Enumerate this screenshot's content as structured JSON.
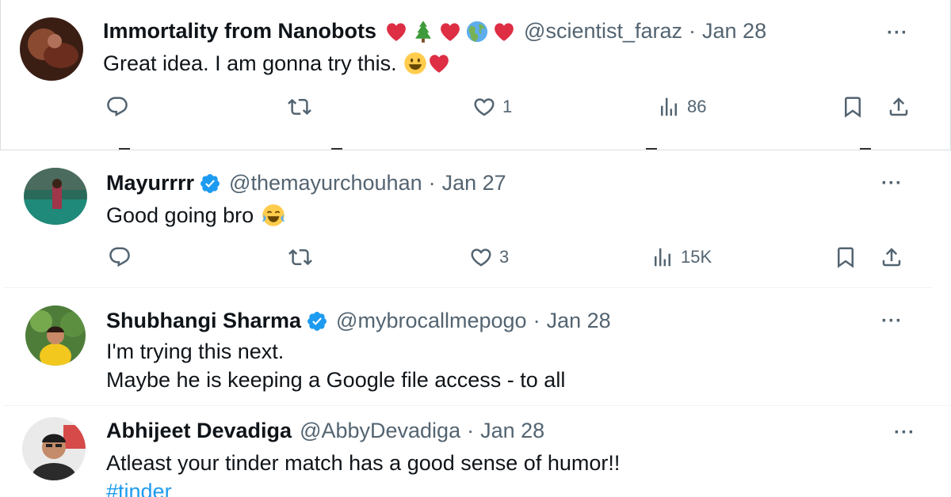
{
  "tweets": [
    {
      "name": "Immortality from Nanobots",
      "name_emojis": [
        "heart",
        "tree",
        "heart",
        "globe",
        "heart"
      ],
      "handle": "@scientist_faraz",
      "separator": "·",
      "date": "Jan 28",
      "text": "Great idea. I am gonna try this.",
      "text_emojis": [
        "smiley",
        "heart"
      ],
      "more": "···",
      "likes": "1",
      "views": "86"
    },
    {
      "name": "Mayurrrr",
      "verified": true,
      "handle": "@themayurchouhan",
      "separator": "·",
      "date": "Jan 27",
      "text": "Good going bro",
      "text_emojis": [
        "joy"
      ],
      "more": "···",
      "likes": "3",
      "views": "15K"
    },
    {
      "name": "Shubhangi Sharma",
      "verified": true,
      "handle": "@mybrocallmepogo",
      "separator": "·",
      "date": "Jan 28",
      "text_line1": "I'm trying this next.",
      "text_line2": "Maybe he is keeping a Google file access - to all",
      "more": "···"
    },
    {
      "name": "Abhijeet Devadiga",
      "handle": "@AbbyDevadiga",
      "separator": "·",
      "date": "Jan 28",
      "text": "Atleast your tinder match has a good sense of humor!!",
      "hashtag": "#tinder",
      "more": "···"
    }
  ],
  "icons": {
    "reply": "reply-icon",
    "retweet": "retweet-icon",
    "like": "heart-icon",
    "views": "views-icon",
    "bookmark": "bookmark-icon",
    "share": "share-icon"
  },
  "colors": {
    "text": "#0f1419",
    "secondary": "#536471",
    "link": "#1d9bf0",
    "verified": "#1d9bf0",
    "heart_emoji": "#e0245e"
  }
}
